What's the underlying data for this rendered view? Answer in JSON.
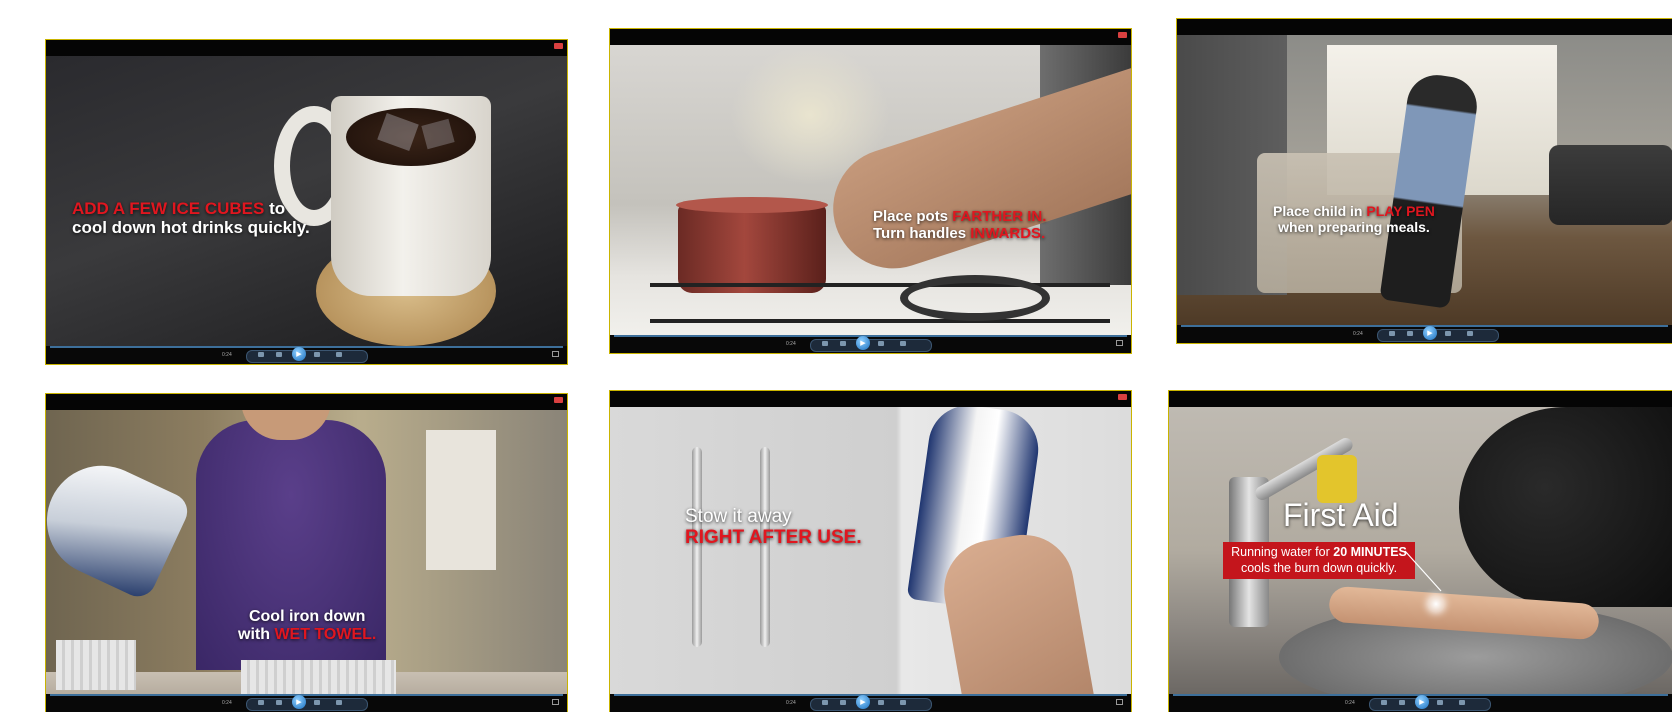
{
  "players": [
    {
      "id": "ice-cubes",
      "caption": {
        "line1_red": "ADD A FEW ICE CUBES",
        "line1_white": " to",
        "line2": "cool down hot drinks quickly."
      },
      "time": "0:24"
    },
    {
      "id": "pots",
      "caption": {
        "line1_white": "Place pots ",
        "line1_red": "FARTHER IN.",
        "line2_white": "Turn handles ",
        "line2_red": "INWARDS."
      },
      "time": "0:24"
    },
    {
      "id": "play-pen",
      "caption": {
        "line1_white": "Place child in ",
        "line1_red": "PLAY PEN",
        "line2": "when preparing meals."
      },
      "time": "0:24"
    },
    {
      "id": "iron-towel",
      "caption": {
        "line1": "Cool iron down",
        "line2_white": "with ",
        "line2_red": "WET TOWEL."
      },
      "time": "0:24"
    },
    {
      "id": "stow-iron",
      "caption": {
        "line1": "Stow it away",
        "line2_red": "RIGHT AFTER USE."
      },
      "time": "0:24"
    },
    {
      "id": "first-aid",
      "caption": {
        "title": "First Aid",
        "line1_white": "Running water for ",
        "line1_bold": "20 MINUTES",
        "line2": "cools the burn down quickly."
      },
      "time": "0:24"
    }
  ],
  "colors": {
    "accent_red": "#e0161f",
    "frame_border": "#c9b400",
    "progress_blue": "#3d6f9a"
  }
}
